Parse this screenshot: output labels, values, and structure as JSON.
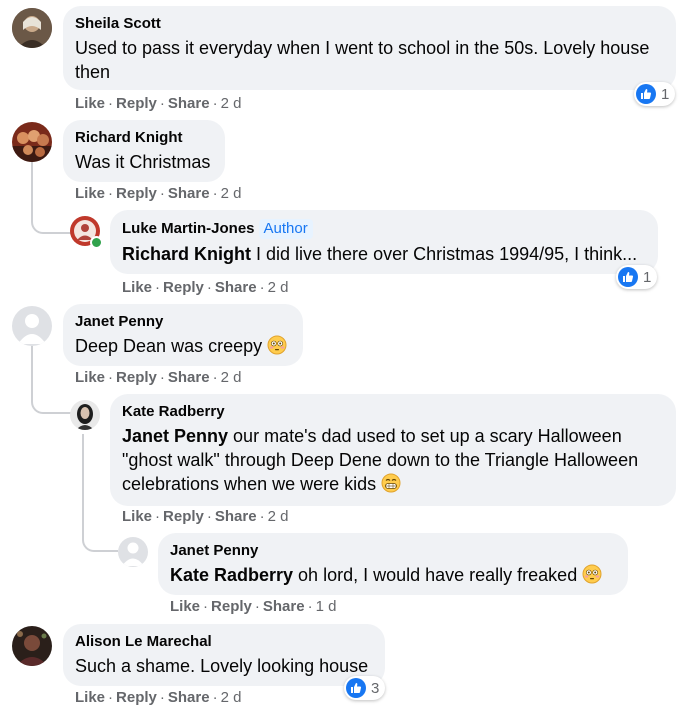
{
  "actions": {
    "like": "Like",
    "reply": "Reply",
    "share": "Share",
    "sep": "·"
  },
  "comments": [
    {
      "name": "Sheila Scott",
      "text": "Used to pass it everyday when I went to school in the 50s. Lovely house then",
      "time": "2 d",
      "reactions": "1"
    },
    {
      "name": "Richard Knight",
      "text": "Was it Christmas",
      "time": "2 d",
      "reply": {
        "name": "Luke Martin-Jones",
        "badge": "Author",
        "tag": "Richard Knight",
        "text": " I did live there over Christmas 1994/95, I think...",
        "time": "2 d",
        "reactions": "1"
      }
    },
    {
      "name": "Janet Penny",
      "text": "Deep Dean was creepy ",
      "time": "2 d",
      "reply": {
        "name": "Kate Radberry",
        "tag": "Janet Penny",
        "text": " our mate's dad used to set up a scary Halloween \"ghost walk\" through Deep Dene down to the Triangle Halloween celebrations when we were kids ",
        "time": "2 d"
      },
      "reply2": {
        "name": "Janet Penny",
        "tag": "Kate Radberry",
        "text": " oh lord, I would have really freaked ",
        "time": "1 d"
      }
    },
    {
      "name": "Alison Le Marechal",
      "text": "Such a shame. Lovely looking house",
      "time": "2 d",
      "reactions": "3"
    }
  ],
  "colors": {
    "link": "#1877f2",
    "bubble": "#f0f2f5",
    "meta": "#65676b",
    "online": "#31a24c"
  },
  "icons": {
    "reaction": "thumbs-up-icon",
    "emoji_flushed": "flushed-face-icon",
    "emoji_grin": "grinning-face-icon"
  }
}
